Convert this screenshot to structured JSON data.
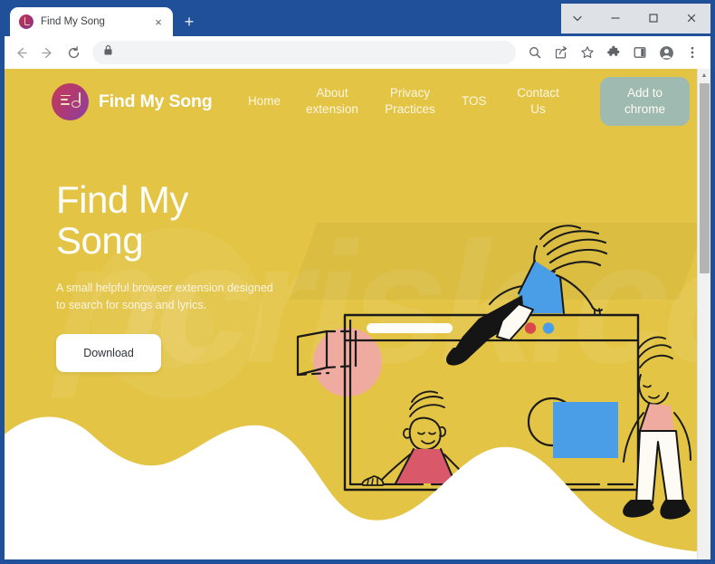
{
  "browser": {
    "tab": {
      "title": "Find My Song",
      "favicon_name": "find-my-song-favicon",
      "close_label": "×"
    },
    "new_tab_label": "+",
    "window_controls": {
      "chevron": "⌄",
      "minimize": "–",
      "maximize": "□",
      "close": "✕"
    },
    "toolbar": {
      "back_icon": "back-arrow-icon",
      "forward_icon": "forward-arrow-icon",
      "reload_icon": "reload-icon",
      "lock_icon": "lock-icon",
      "url": "",
      "url_placeholder": "",
      "right_icons": [
        "zoom-search-icon",
        "share-icon",
        "bookmark-star-icon",
        "extensions-puzzle-icon",
        "side-panel-icon",
        "profile-avatar-icon",
        "three-dot-menu-icon"
      ]
    },
    "scrollbar": {
      "up_arrow": "▲"
    }
  },
  "site": {
    "brand": {
      "name": "Find My Song",
      "logo_name": "find-my-song-logo"
    },
    "nav": [
      {
        "label": "Home"
      },
      {
        "label": "About extension"
      },
      {
        "label": "Privacy Practices"
      },
      {
        "label": "TOS"
      },
      {
        "label": "Contact Us"
      }
    ],
    "cta": {
      "label": "Add to chrome",
      "color": "#9ebab1"
    },
    "hero": {
      "title_line1": "Find My",
      "title_line2": "Song",
      "subtitle": "A small helpful browser extension designed to search for songs and lyrics.",
      "download_label": "Download"
    },
    "watermark": "pcrisk.com",
    "colors": {
      "background": "#e3c444",
      "accent_green": "#9ebab1",
      "blue": "#4a9ee8",
      "coral": "#d9596a",
      "pink": "#f0aba0",
      "white": "#ffffff"
    },
    "illustration": {
      "name": "people-with-browser-window-illustration",
      "browser_dots": [
        "#f0b4ae",
        "#d9484d",
        "#4a9ee8"
      ]
    }
  }
}
